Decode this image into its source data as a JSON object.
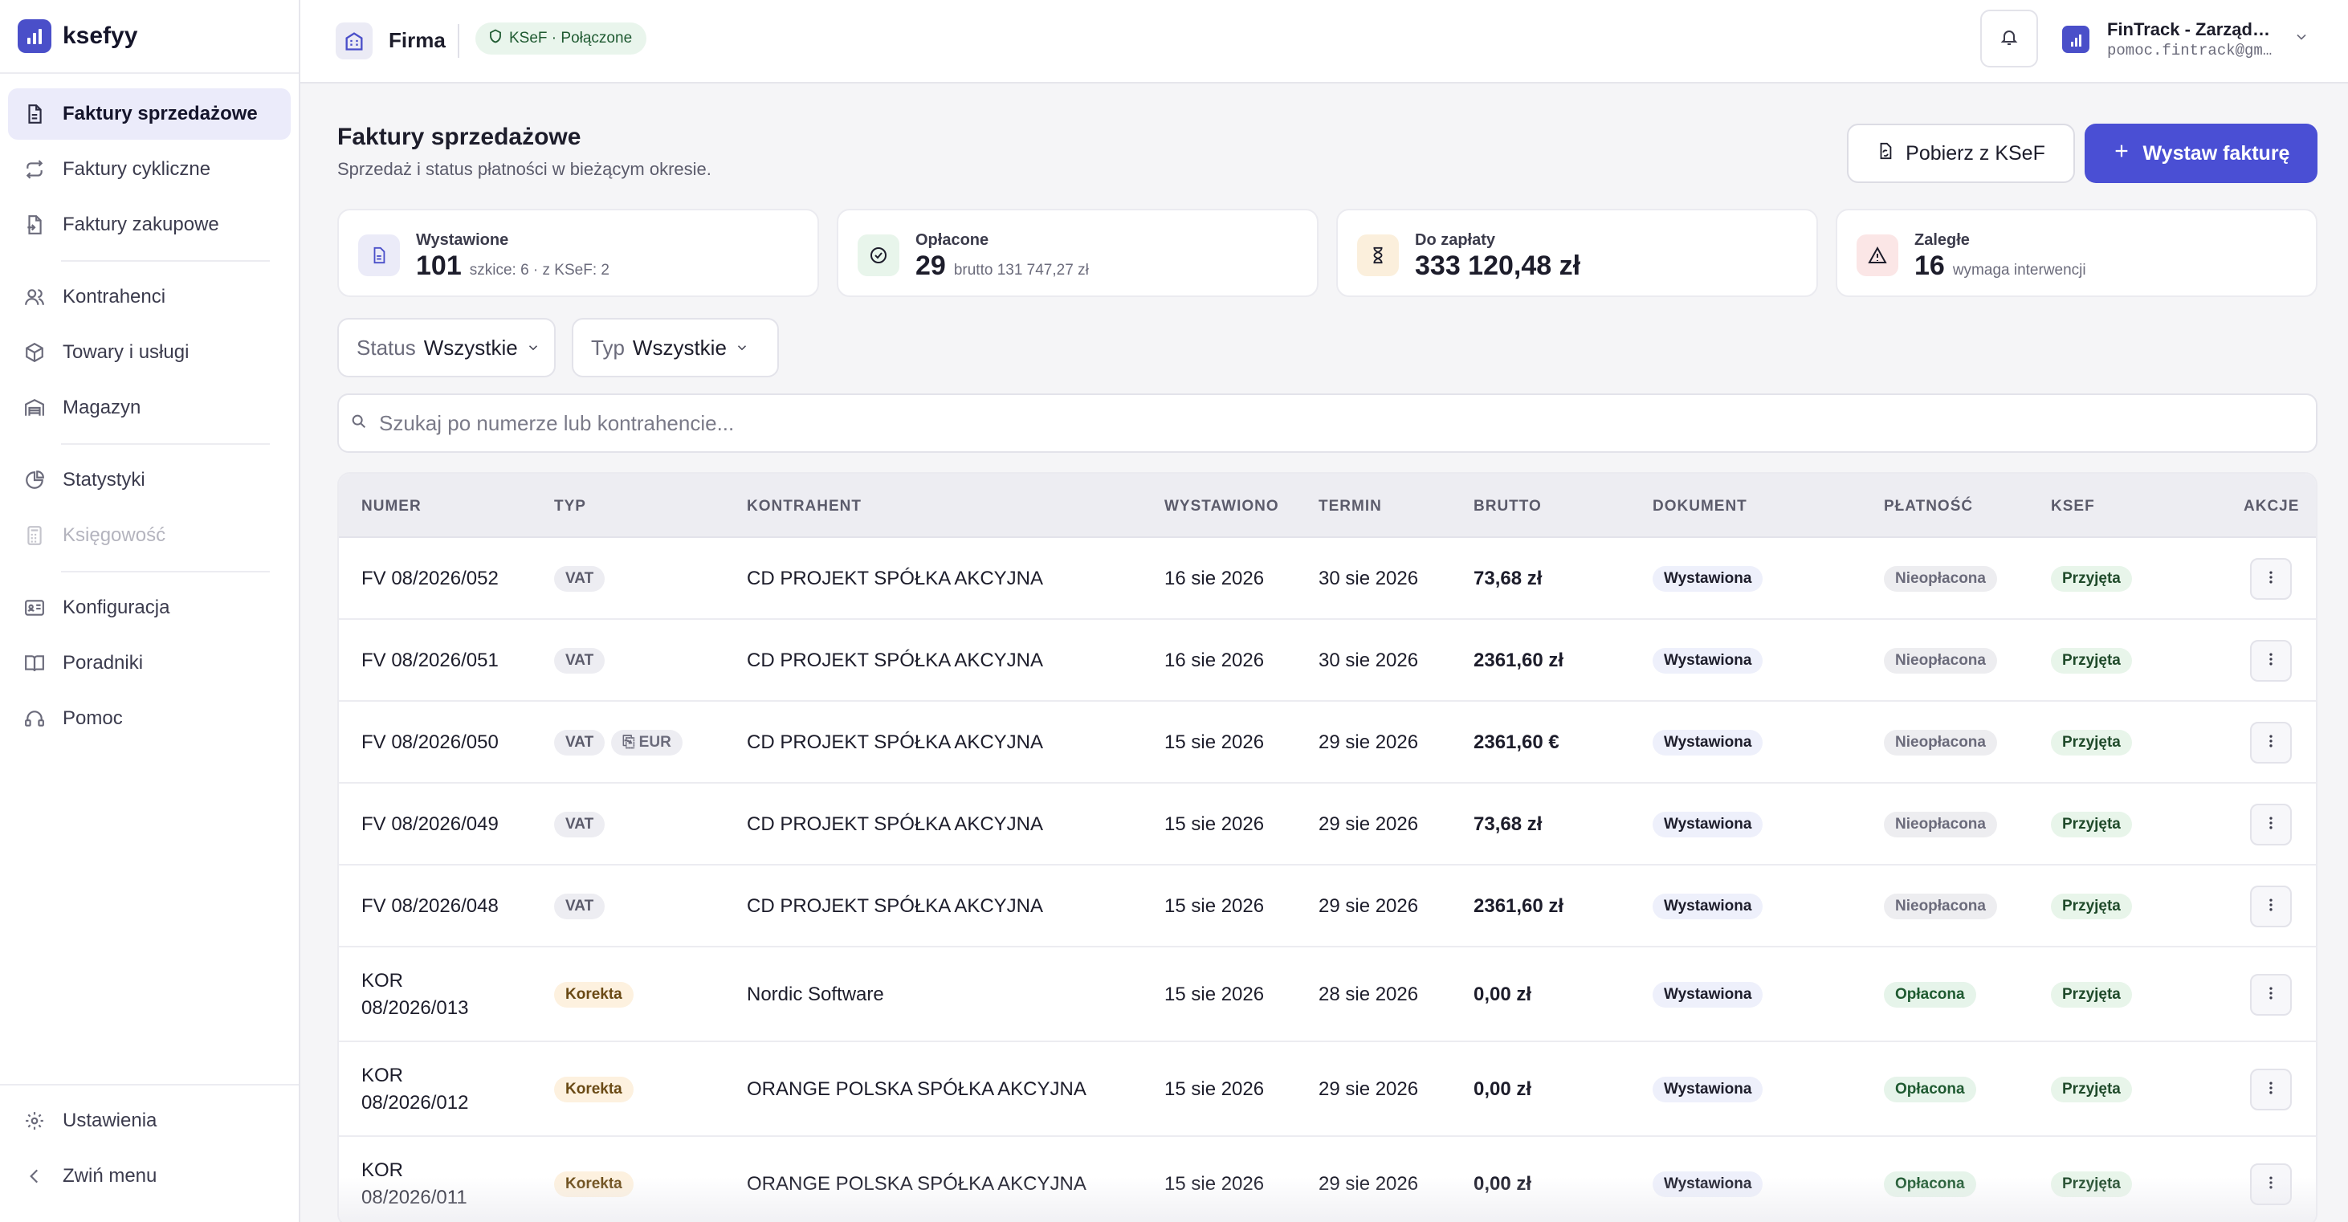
{
  "app": {
    "name": "ksefyy"
  },
  "sidebar": {
    "items": [
      {
        "label": "Faktury sprzedażowe",
        "icon": "file-invoice-icon"
      },
      {
        "label": "Faktury cykliczne",
        "icon": "repeat-icon"
      },
      {
        "label": "Faktury zakupowe",
        "icon": "file-import-icon"
      },
      {
        "label": "Kontrahenci",
        "icon": "users-icon"
      },
      {
        "label": "Towary i usługi",
        "icon": "box-icon"
      },
      {
        "label": "Magazyn",
        "icon": "warehouse-icon"
      },
      {
        "label": "Statystyki",
        "icon": "pie-chart-icon"
      },
      {
        "label": "Księgowość",
        "icon": "calculator-icon"
      },
      {
        "label": "Konfiguracja",
        "icon": "id-card-icon"
      },
      {
        "label": "Poradniki",
        "icon": "book-icon"
      },
      {
        "label": "Pomoc",
        "icon": "headset-icon"
      }
    ],
    "bottom": {
      "settings": "Ustawienia",
      "collapse": "Zwiń menu"
    }
  },
  "topbar": {
    "firm": "Firma",
    "ksef_status": "KSeF · Połączone",
    "org_name": "FinTrack - Zarządzanie",
    "org_email": "pomoc.fintrack@gmail.com"
  },
  "page": {
    "title": "Faktury sprzedażowe",
    "subtitle": "Sprzedaż i status płatności w bieżącym okresie.",
    "btn_fetch": "Pobierz z KSeF",
    "btn_new": "Wystaw fakturę"
  },
  "stats": [
    {
      "label": "Wystawione",
      "value": "101",
      "note": "szkice: 6 · z KSeF: 2"
    },
    {
      "label": "Opłacone",
      "value": "29",
      "note": "brutto 131 747,27 zł"
    },
    {
      "label": "Do zapłaty",
      "value": "333 120,48 zł",
      "note": ""
    },
    {
      "label": "Zaległe",
      "value": "16",
      "note": "wymaga interwencji"
    }
  ],
  "filters": {
    "status_label": "Status",
    "status_value": "Wszystkie",
    "type_label": "Typ",
    "type_value": "Wszystkie"
  },
  "search": {
    "placeholder": "Szukaj po numerze lub kontrahencie..."
  },
  "table": {
    "headers": [
      "NUMER",
      "TYP",
      "KONTRAHENT",
      "WYSTAWIONO",
      "TERMIN",
      "BRUTTO",
      "DOKUMENT",
      "PŁATNOŚĆ",
      "KSEF",
      "AKCJE"
    ],
    "rows": [
      {
        "num1": "FV 08/2026/052",
        "num2": "",
        "type": "VAT",
        "currency": "",
        "client": "CD PROJEKT SPÓŁKA AKCYJNA",
        "issued": "16 sie 2026",
        "due": "30 sie 2026",
        "gross": "73,68 zł",
        "doc": "Wystawiona",
        "payment": "Nieopłacona",
        "ksef": "Przyjęta"
      },
      {
        "num1": "FV 08/2026/051",
        "num2": "",
        "type": "VAT",
        "currency": "",
        "client": "CD PROJEKT SPÓŁKA AKCYJNA",
        "issued": "16 sie 2026",
        "due": "30 sie 2026",
        "gross": "2361,60 zł",
        "doc": "Wystawiona",
        "payment": "Nieopłacona",
        "ksef": "Przyjęta"
      },
      {
        "num1": "FV 08/2026/050",
        "num2": "",
        "type": "VAT",
        "currency": "EUR",
        "client": "CD PROJEKT SPÓŁKA AKCYJNA",
        "issued": "15 sie 2026",
        "due": "29 sie 2026",
        "gross": "2361,60 €",
        "doc": "Wystawiona",
        "payment": "Nieopłacona",
        "ksef": "Przyjęta"
      },
      {
        "num1": "FV 08/2026/049",
        "num2": "",
        "type": "VAT",
        "currency": "",
        "client": "CD PROJEKT SPÓŁKA AKCYJNA",
        "issued": "15 sie 2026",
        "due": "29 sie 2026",
        "gross": "73,68 zł",
        "doc": "Wystawiona",
        "payment": "Nieopłacona",
        "ksef": "Przyjęta"
      },
      {
        "num1": "FV 08/2026/048",
        "num2": "",
        "type": "VAT",
        "currency": "",
        "client": "CD PROJEKT SPÓŁKA AKCYJNA",
        "issued": "15 sie 2026",
        "due": "29 sie 2026",
        "gross": "2361,60 zł",
        "doc": "Wystawiona",
        "payment": "Nieopłacona",
        "ksef": "Przyjęta"
      },
      {
        "num1": "KOR",
        "num2": "08/2026/013",
        "type": "Korekta",
        "currency": "",
        "client": "Nordic Software",
        "issued": "15 sie 2026",
        "due": "28 sie 2026",
        "gross": "0,00 zł",
        "doc": "Wystawiona",
        "payment": "Opłacona",
        "ksef": "Przyjęta"
      },
      {
        "num1": "KOR",
        "num2": "08/2026/012",
        "type": "Korekta",
        "currency": "",
        "client": "ORANGE POLSKA SPÓŁKA AKCYJNA",
        "issued": "15 sie 2026",
        "due": "29 sie 2026",
        "gross": "0,00 zł",
        "doc": "Wystawiona",
        "payment": "Opłacona",
        "ksef": "Przyjęta"
      },
      {
        "num1": "KOR",
        "num2": "08/2026/011",
        "type": "Korekta",
        "currency": "",
        "client": "ORANGE POLSKA SPÓŁKA AKCYJNA",
        "issued": "15 sie 2026",
        "due": "29 sie 2026",
        "gross": "0,00 zł",
        "doc": "Wystawiona",
        "payment": "Opłacona",
        "ksef": "Przyjęta"
      }
    ]
  },
  "colors": {
    "accent": "#4a4fd4",
    "active_nav_bg": "#ebebfa",
    "paid": "#1f5a31",
    "correction": "#6a4a15"
  }
}
